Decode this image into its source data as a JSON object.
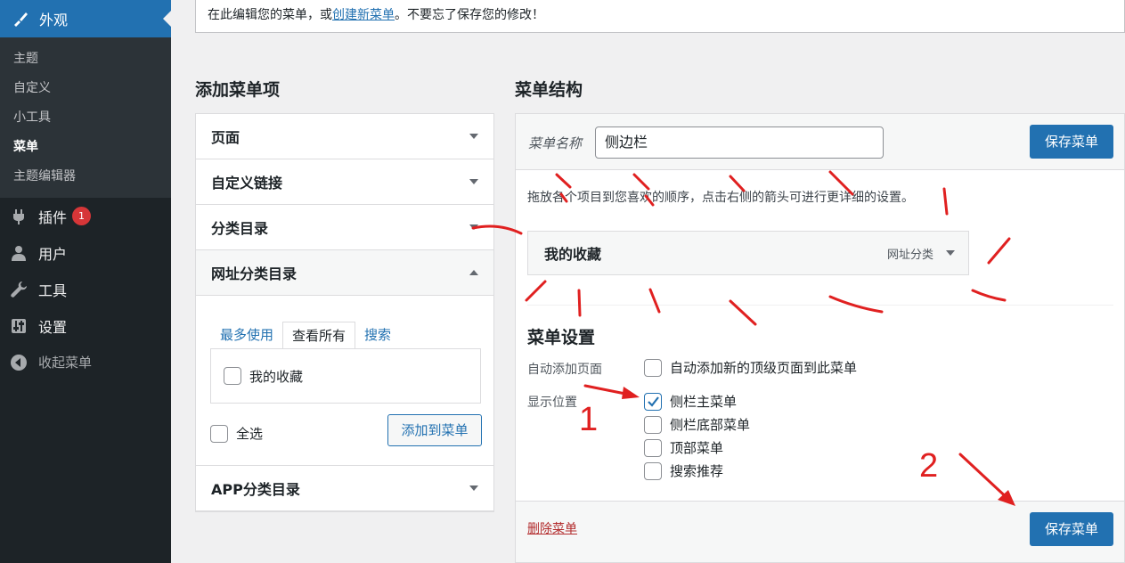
{
  "sidebar": {
    "header": "外观",
    "submenu": [
      "主题",
      "自定义",
      "小工具",
      "菜单",
      "主题编辑器"
    ],
    "current_submenu": "菜单",
    "items": [
      {
        "label": "插件",
        "badge": "1",
        "icon": "plugin-icon"
      },
      {
        "label": "用户",
        "icon": "user-icon"
      },
      {
        "label": "工具",
        "icon": "wrench-icon"
      },
      {
        "label": "设置",
        "icon": "settings-icon"
      },
      {
        "label": "收起菜单",
        "icon": "collapse-icon"
      }
    ]
  },
  "notice": {
    "before": "在此编辑您的菜单，或",
    "link": "创建新菜单",
    "after": "。不要忘了保存您的修改！"
  },
  "left": {
    "title": "添加菜单项",
    "sections": [
      "页面",
      "自定义链接",
      "分类目录",
      "网址分类目录",
      "APP分类目录"
    ],
    "tabs": [
      "最多使用",
      "查看所有",
      "搜索"
    ],
    "active_tab": "查看所有",
    "item": "我的收藏",
    "select_all": "全选",
    "add_button": "添加到菜单"
  },
  "right": {
    "title": "菜单结构",
    "menu_name_label": "菜单名称",
    "menu_name_value": "侧边栏",
    "save_button": "保存菜单",
    "instructions": "拖放各个项目到您喜欢的顺序，点击右侧的箭头可进行更详细的设置。",
    "menu_item": {
      "title": "我的收藏",
      "type": "网址分类"
    },
    "settings_title": "菜单设置",
    "auto_add_label": "自动添加页面",
    "auto_add_option": "自动添加新的顶级页面到此菜单",
    "location_label": "显示位置",
    "locations": [
      {
        "label": "侧栏主菜单",
        "checked": true
      },
      {
        "label": "侧栏底部菜单",
        "checked": false
      },
      {
        "label": "顶部菜单",
        "checked": false
      },
      {
        "label": "搜索推荐",
        "checked": false
      }
    ],
    "delete_link": "删除菜单",
    "save_button_bottom": "保存菜单"
  },
  "annotations": {
    "step1": "1",
    "step2": "2"
  },
  "colors": {
    "accent": "#2271b1",
    "sidebar": "#1d2327",
    "annotation": "#e02020"
  }
}
